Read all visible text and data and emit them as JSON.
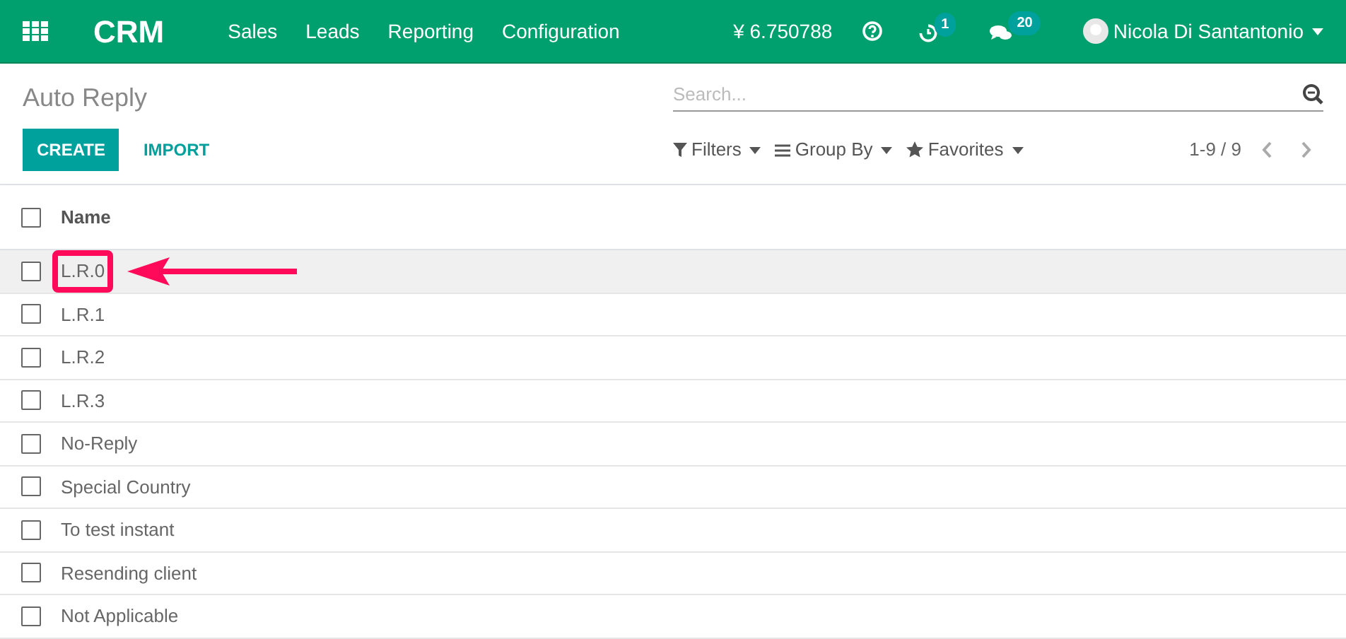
{
  "navbar": {
    "app_name": "CRM",
    "menu": [
      "Sales",
      "Leads",
      "Reporting",
      "Configuration"
    ],
    "balance": "¥ 6.750788",
    "activity_count": "1",
    "message_count": "20",
    "user_name": "Nicola Di Santantonio"
  },
  "control_panel": {
    "title": "Auto Reply",
    "search": {
      "placeholder": "Search..."
    },
    "buttons": [
      {
        "label": "CREATE",
        "kind": "primary"
      },
      {
        "label": "IMPORT",
        "kind": "link"
      }
    ],
    "filters": [
      {
        "label": "Filters",
        "kind": "filter"
      },
      {
        "label": "Group By",
        "kind": "group"
      },
      {
        "label": "Favorites",
        "kind": "star"
      }
    ],
    "pager": "1-9 / 9"
  },
  "table": {
    "columns": [
      "Name"
    ],
    "header_checked": false,
    "rows": [
      {
        "name": "L.R.0",
        "checked": false,
        "highlighted": true,
        "callout": true
      },
      {
        "name": "L.R.1",
        "checked": false,
        "highlighted": false,
        "callout": false
      },
      {
        "name": "L.R.2",
        "checked": false,
        "highlighted": false,
        "callout": false
      },
      {
        "name": "L.R.3",
        "checked": false,
        "highlighted": false,
        "callout": false
      },
      {
        "name": "No-Reply",
        "checked": false,
        "highlighted": false,
        "callout": false
      },
      {
        "name": "Special Country",
        "checked": false,
        "highlighted": false,
        "callout": false
      },
      {
        "name": "To test instant",
        "checked": false,
        "highlighted": false,
        "callout": false
      },
      {
        "name": "Resending client",
        "checked": false,
        "highlighted": false,
        "callout": false
      },
      {
        "name": "Not Applicable",
        "checked": false,
        "highlighted": false,
        "callout": false
      }
    ]
  }
}
